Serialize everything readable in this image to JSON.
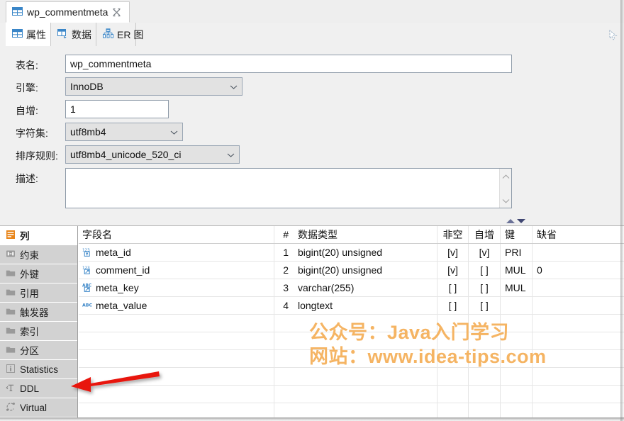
{
  "editor_tab": {
    "title": "wp_commentmeta",
    "icon": "table-icon",
    "close_icon": "close-icon"
  },
  "inner_tabs": [
    {
      "label": "属性",
      "icon": "table-properties-icon",
      "selected": true
    },
    {
      "label": "数据",
      "icon": "data-grid-icon",
      "selected": false
    },
    {
      "label": "ER 图",
      "icon": "er-diagram-icon",
      "selected": false
    }
  ],
  "form": {
    "table_name": {
      "label": "表名:",
      "value": "wp_commentmeta"
    },
    "engine": {
      "label": "引擎:",
      "value": "InnoDB"
    },
    "auto_inc": {
      "label": "自增:",
      "value": "1"
    },
    "charset": {
      "label": "字符集:",
      "value": "utf8mb4"
    },
    "collation": {
      "label": "排序规则:",
      "value": "utf8mb4_unicode_520_ci"
    },
    "comment": {
      "label": "描述:",
      "value": ""
    }
  },
  "categories": [
    {
      "label": "列",
      "icon": "columns-icon",
      "selected": true
    },
    {
      "label": "约束",
      "icon": "constraint-icon",
      "selected": false
    },
    {
      "label": "外键",
      "icon": "folder-icon",
      "selected": false
    },
    {
      "label": "引用",
      "icon": "folder-icon",
      "selected": false
    },
    {
      "label": "触发器",
      "icon": "folder-icon",
      "selected": false
    },
    {
      "label": "索引",
      "icon": "folder-icon",
      "selected": false
    },
    {
      "label": "分区",
      "icon": "folder-icon",
      "selected": false
    },
    {
      "label": "Statistics",
      "icon": "info-icon",
      "selected": false
    },
    {
      "label": "DDL",
      "icon": "text-ddl-icon",
      "selected": false
    },
    {
      "label": "Virtual",
      "icon": "virtual-icon",
      "selected": false
    }
  ],
  "grid": {
    "headers": {
      "name": "字段名",
      "num": "#",
      "type": "数据类型",
      "notnull": "非空",
      "autoinc": "自增",
      "key": "键",
      "default": "缺省"
    },
    "rows": [
      {
        "icon": "number-key-icon",
        "name": "meta_id",
        "num": "1",
        "type": "bigint(20) unsigned",
        "notnull": "[v]",
        "autoinc": "[v]",
        "key": "PRI",
        "default": ""
      },
      {
        "icon": "number-index-icon",
        "name": "comment_id",
        "num": "2",
        "type": "bigint(20) unsigned",
        "notnull": "[v]",
        "autoinc": "[ ]",
        "key": "MUL",
        "default": "0"
      },
      {
        "icon": "text-index-icon",
        "name": "meta_key",
        "num": "3",
        "type": "varchar(255)",
        "notnull": "[ ]",
        "autoinc": "[ ]",
        "key": "MUL",
        "default": ""
      },
      {
        "icon": "text-icon",
        "name": "meta_value",
        "num": "4",
        "type": "longtext",
        "notnull": "[ ]",
        "autoinc": "[ ]",
        "key": "",
        "default": ""
      }
    ]
  },
  "watermark": {
    "line1": "公众号：Java入门学习",
    "line2": "网站：www.idea-tips.com",
    "color": "#f5b463"
  },
  "annotation": {
    "arrow_color": "#e8120c",
    "points_to": "DDL"
  },
  "colors": {
    "accent_orange": "#e8851a",
    "icon_blue": "#3a86c8",
    "panel_bg": "#f0f0f0",
    "list_bg": "#d2d2d2"
  }
}
